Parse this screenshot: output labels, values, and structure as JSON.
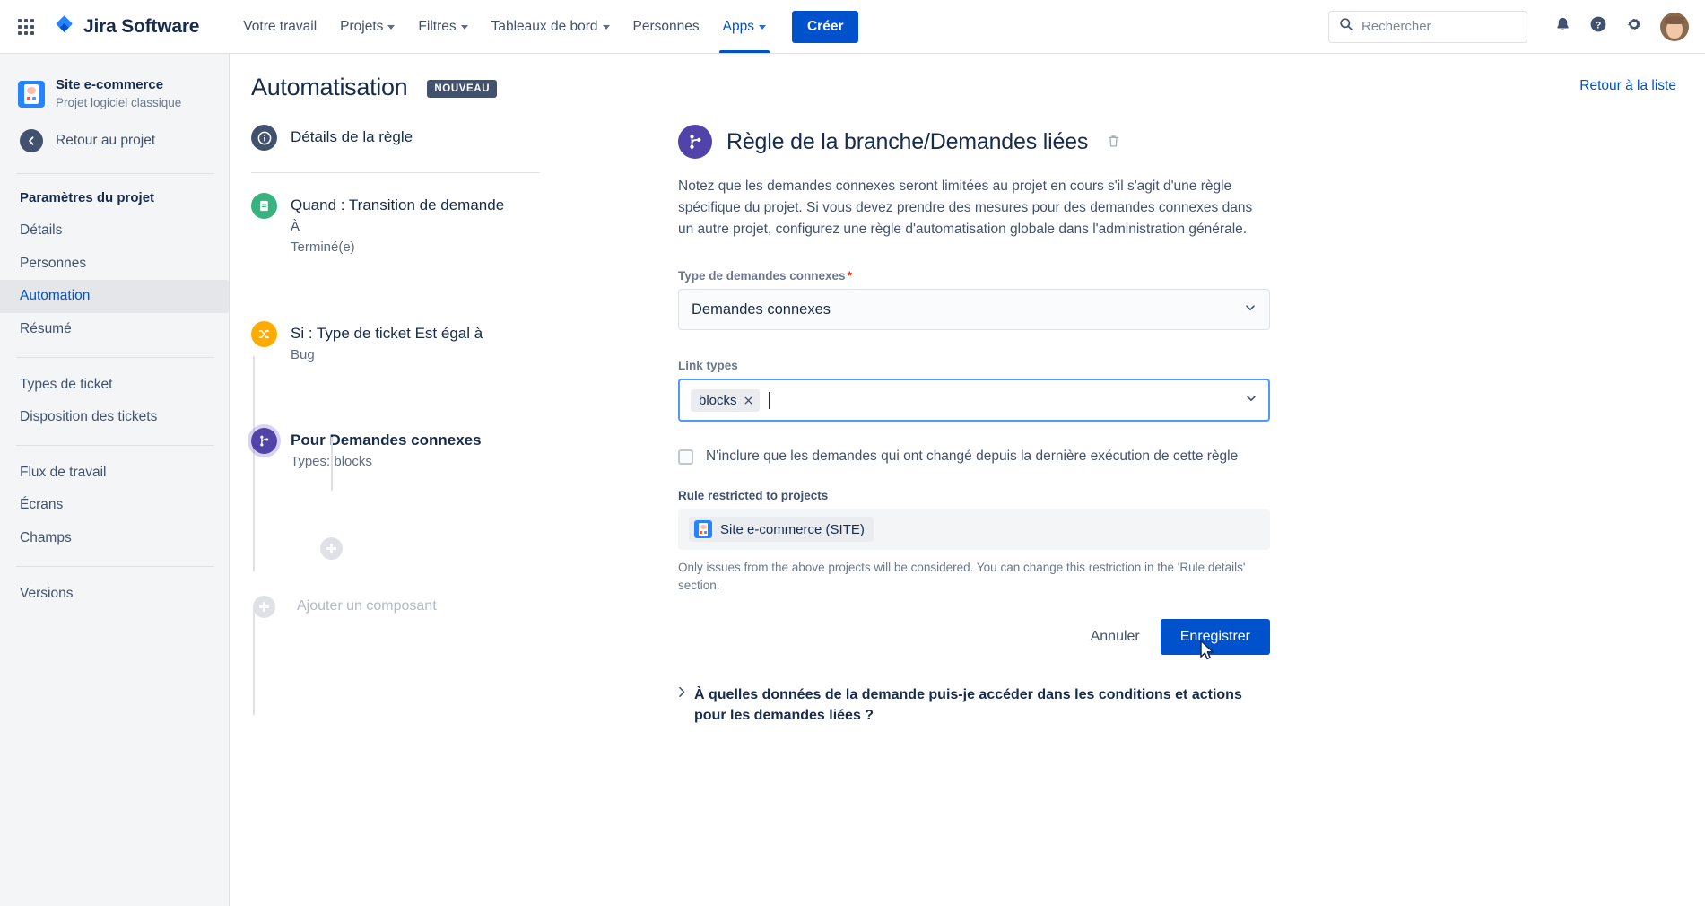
{
  "topnav": {
    "app_switcher_icon": "grid-apps-icon",
    "brand": "Jira Software",
    "brand_icon": "jira-logo-icon",
    "items": [
      {
        "label": "Votre travail",
        "has_caret": false,
        "active": false
      },
      {
        "label": "Projets",
        "has_caret": true,
        "active": false
      },
      {
        "label": "Filtres",
        "has_caret": true,
        "active": false
      },
      {
        "label": "Tableaux de bord",
        "has_caret": true,
        "active": false
      },
      {
        "label": "Personnes",
        "has_caret": false,
        "active": false
      },
      {
        "label": "Apps",
        "has_caret": true,
        "active": true
      }
    ],
    "create_label": "Créer",
    "search_placeholder": "Rechercher",
    "search_value": "",
    "search_icon": "search-icon",
    "notifications_icon": "bell-icon",
    "help_icon": "question-circle-icon",
    "settings_icon": "gear-icon",
    "avatar_icon": "user-avatar"
  },
  "sidebar": {
    "project_name": "Site e-commerce",
    "project_type": "Projet logiciel classique",
    "back_label": "Retour au projet",
    "back_icon": "arrow-left-circle-icon",
    "section_title": "Paramètres du projet",
    "group1": [
      {
        "label": "Détails",
        "active": false
      },
      {
        "label": "Personnes",
        "active": false
      },
      {
        "label": "Automation",
        "active": true
      },
      {
        "label": "Résumé",
        "active": false
      }
    ],
    "group2": [
      {
        "label": "Types de ticket",
        "active": false
      },
      {
        "label": "Disposition des tickets",
        "active": false
      }
    ],
    "group3": [
      {
        "label": "Flux de travail",
        "active": false
      },
      {
        "label": "Écrans",
        "active": false
      },
      {
        "label": "Champs",
        "active": false
      }
    ],
    "group4": [
      {
        "label": "Versions",
        "active": false
      }
    ]
  },
  "page": {
    "title": "Automatisation",
    "badge": "NOUVEAU",
    "back_to_list": "Retour à la liste"
  },
  "builder": {
    "rule_details": {
      "title": "Détails de la règle",
      "icon": "info-circle-icon"
    },
    "nodes": [
      {
        "title": "Quand : Transition de demande",
        "sub1": "À",
        "sub2": "Terminé(e)",
        "icon": "trigger-transition-icon",
        "bold": false
      },
      {
        "title": "Si : Type de ticket Est égal à",
        "sub1": "Bug",
        "sub2": "",
        "icon": "condition-shuffle-icon",
        "bold": false
      },
      {
        "title": "Pour Demandes connexes",
        "sub1": "Types: blocks",
        "sub2": "",
        "icon": "branch-icon",
        "bold": true
      }
    ],
    "add_component_label": "Ajouter un composant",
    "add_icon": "plus-circle-icon"
  },
  "detail": {
    "icon": "branch-icon",
    "title": "Règle de la branche/Demandes liées",
    "delete_icon": "trash-icon",
    "description": "Notez que les demandes connexes seront limitées au projet en cours s'il s'agit d'une règle spécifique du projet. Si vous devez prendre des mesures pour des demandes connexes dans un autre projet, configurez une règle d'automatisation globale dans l'administration générale.",
    "type_field": {
      "label": "Type de demandes connexes",
      "required_marker": "*",
      "value": "Demandes connexes",
      "chevron_icon": "chevron-down-icon"
    },
    "link_types_field": {
      "label": "Link types",
      "chips": [
        {
          "text": "blocks",
          "remove_icon": "close-x-icon"
        }
      ],
      "chevron_icon": "chevron-down-icon"
    },
    "checkbox_row": {
      "checked": false,
      "label": "N'inclure que les demandes qui ont changé depuis la dernière exécution de cette règle"
    },
    "restricted": {
      "label": "Rule restricted to projects",
      "project_chip": "Site e-commerce (SITE)",
      "project_icon": "project-avatar-icon",
      "help": "Only issues from the above projects will be considered. You can change this restriction in the 'Rule details' section."
    },
    "actions": {
      "cancel": "Annuler",
      "save": "Enregistrer",
      "cursor_icon": "mouse-pointer-icon"
    },
    "expander": {
      "chevron_icon": "chevron-right-icon",
      "text": "À quelles données de la demande puis-je accéder dans les conditions et actions pour les demandes liées ?"
    }
  }
}
